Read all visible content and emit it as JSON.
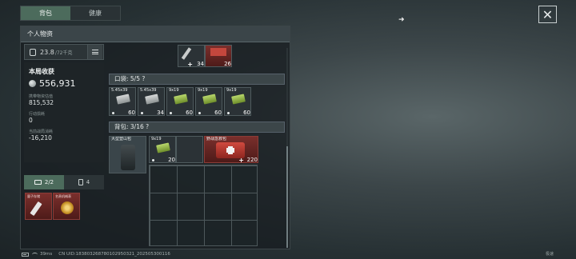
{
  "tabs": [
    {
      "label": "背包",
      "active": true
    },
    {
      "label": "健康",
      "active": false
    }
  ],
  "panel": {
    "title": "个人物资",
    "weight_value": "23.8",
    "weight_max": "/72千克"
  },
  "stats": {
    "heading": "本局收获",
    "total": "556,931",
    "carry_label": "携带物资估值",
    "carry_value": "815,532",
    "loss_label": "行动损耗",
    "loss_value": "0",
    "net_label": "当前战局消耗",
    "net_value": "-16,210"
  },
  "equip_tabs": {
    "tab1_label": "2/2",
    "tab2_label": "4"
  },
  "equip_items": [
    {
      "label": "量子存储"
    },
    {
      "label": "名贵机械表"
    }
  ],
  "top_items": [
    {
      "count": "34"
    },
    {
      "count": "26"
    }
  ],
  "pocket": {
    "header": "口袋: 5/5 ?",
    "items": [
      {
        "tag": "5.45x39",
        "sub": "PS",
        "count": "60",
        "color": "grey"
      },
      {
        "tag": "5.45x39",
        "sub": "PS",
        "count": "34",
        "color": "grey"
      },
      {
        "tag": "9x19",
        "sub": "PS",
        "count": "60",
        "color": "green"
      },
      {
        "tag": "9x19",
        "sub": "PS",
        "count": "60",
        "color": "green"
      },
      {
        "tag": "9x19",
        "sub": "PS",
        "count": "60",
        "color": "green"
      }
    ]
  },
  "backpack": {
    "header": "背包: 3/16 ?",
    "items": [
      {
        "tag": "大型登山包",
        "sub": "四级",
        "count": ""
      },
      {
        "tag": "9x19",
        "sub": "PS",
        "count": "20"
      },
      {
        "tag": "野战急救包",
        "sub": "",
        "count": "220"
      }
    ]
  },
  "status": {
    "ping": "39ms",
    "uid": "CN UID:18380326878010295032­1_202505300116",
    "right": "极速"
  },
  "icons": {
    "close": "close-icon",
    "lock": "lock-icon",
    "list": "list-icon",
    "coin": "coin-icon"
  }
}
